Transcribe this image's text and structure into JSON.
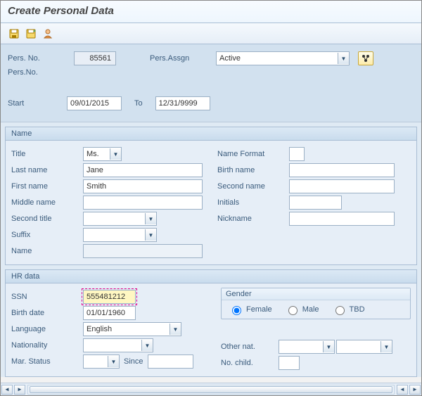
{
  "window": {
    "title": "Create Personal Data"
  },
  "header": {
    "persno_label": "Pers. No.",
    "persno_value": "85561",
    "persassgn_label": "Pers.Assgn",
    "persassgn_value": "Active",
    "persno2_label": "Pers.No.",
    "start_label": "Start",
    "start_value": "09/01/2015",
    "to_label": "To",
    "end_value": "12/31/9999"
  },
  "name_group": {
    "legend": "Name",
    "title_label": "Title",
    "title_value": "Ms.",
    "lastname_label": "Last name",
    "lastname_value": "Jane",
    "firstname_label": "First name",
    "firstname_value": "Smith",
    "middlename_label": "Middle name",
    "middlename_value": "",
    "secondtitle_label": "Second title",
    "secondtitle_value": "",
    "suffix_label": "Suffix",
    "suffix_value": "",
    "name_label": "Name",
    "name_value": "",
    "nameformat_label": "Name Format",
    "nameformat_value": "",
    "birthname_label": "Birth name",
    "birthname_value": "",
    "secondname_label": "Second name",
    "secondname_value": "",
    "initials_label": "Initials",
    "initials_value": "",
    "nickname_label": "Nickname",
    "nickname_value": ""
  },
  "hr_group": {
    "legend": "HR data",
    "ssn_label": "SSN",
    "ssn_value": "555481212",
    "birthdate_label": "Birth date",
    "birthdate_value": "01/01/1960",
    "language_label": "Language",
    "language_value": "English",
    "nationality_label": "Nationality",
    "nationality_value": "",
    "marstatus_label": "Mar. Status",
    "marstatus_value": "",
    "since_label": "Since",
    "since_value": "",
    "gender_legend": "Gender",
    "gender_female": "Female",
    "gender_male": "Male",
    "gender_tbd": "TBD",
    "gender_value": "Female",
    "othernat_label": "Other nat.",
    "othernat_value": "",
    "nochild_label": "No. child.",
    "nochild_value": ""
  }
}
